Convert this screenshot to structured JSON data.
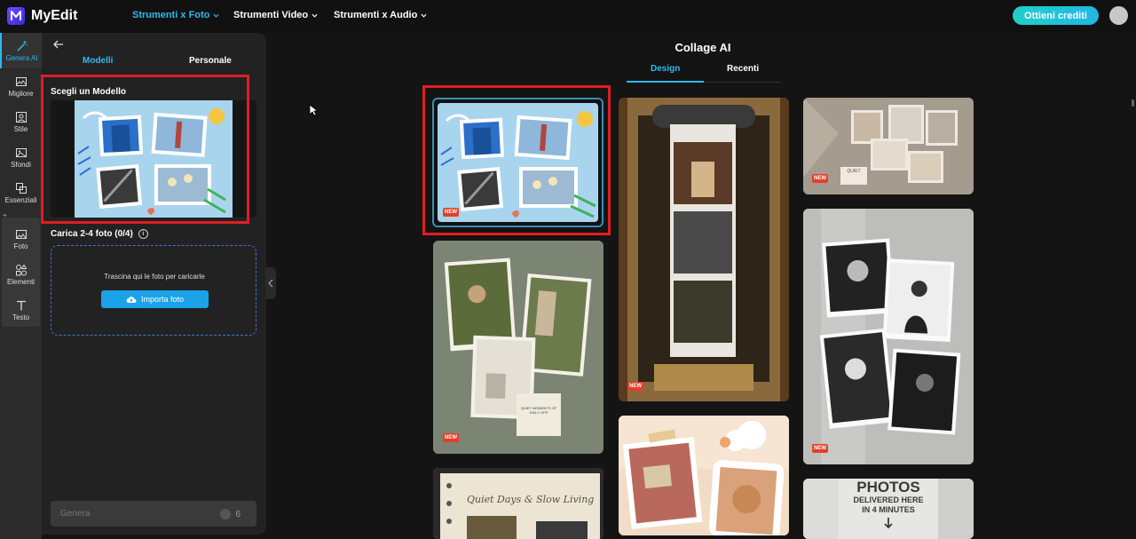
{
  "brand": {
    "name": "MyEdit"
  },
  "nav": [
    {
      "label": "Strumenti x Foto",
      "active": true
    },
    {
      "label": "Strumenti Video",
      "active": false
    },
    {
      "label": "Strumenti x Audio",
      "active": false
    }
  ],
  "header": {
    "credits_label": "Ottieni crediti"
  },
  "rail": [
    {
      "label": "Genera AI",
      "icon": "magic-wand-icon",
      "active": true
    },
    {
      "label": "Migliore",
      "icon": "image-enhance-icon"
    },
    {
      "label": "Stile",
      "icon": "portrait-style-icon"
    },
    {
      "label": "Sfondi",
      "icon": "background-image-icon"
    },
    {
      "label": "Essenziali",
      "icon": "crop-icon"
    },
    {
      "label": "Foto",
      "icon": "photo-icon"
    },
    {
      "label": "Elementi",
      "icon": "shapes-icon"
    },
    {
      "label": "Testo",
      "icon": "text-icon"
    }
  ],
  "panel": {
    "tabs": [
      "Modelli",
      "Personale"
    ],
    "section_title": "Scegli un Modello",
    "upload_title": "Carica 2-4 foto (0/4)",
    "drop_text": "Trascina qui le foto per caricarle",
    "import_label": "Importa foto",
    "generate_label": "Genera",
    "generate_cost": "6"
  },
  "main": {
    "title": "Collage AI",
    "tabs": [
      "Design",
      "Recenti"
    ],
    "new_badge": "NEW",
    "card_texts": {
      "quiet_label": "QUIET",
      "quiet_days": "Quiet Days & Slow Living",
      "quiet_moments": "QUIET MOMENTS OF DAILY LIFE",
      "photos": "PHOTOS",
      "delivered": "DELIVERED HERE",
      "minutes": "IN 4 MINUTES"
    }
  },
  "colors": {
    "accent": "#2fb9ef",
    "highlight": "#e01e23",
    "new_badge": "#e3402a"
  }
}
